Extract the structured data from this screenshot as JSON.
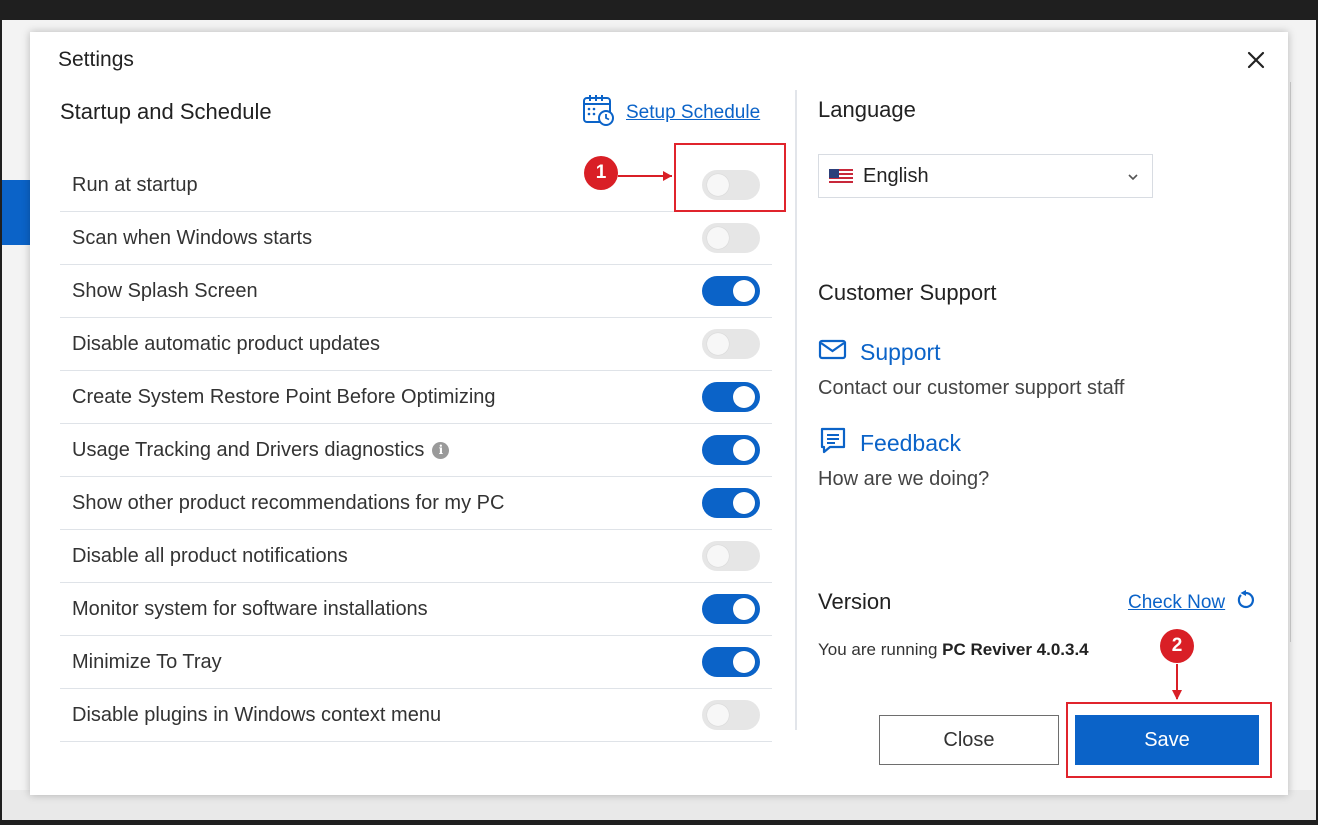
{
  "dialog": {
    "title": "Settings"
  },
  "startup": {
    "heading": "Startup and Schedule",
    "schedule_link": "Setup Schedule",
    "items": [
      {
        "label": "Run at startup",
        "on": false
      },
      {
        "label": "Scan when Windows starts",
        "on": false
      },
      {
        "label": "Show Splash Screen",
        "on": true
      },
      {
        "label": "Disable automatic product updates",
        "on": false
      },
      {
        "label": "Create System Restore Point Before Optimizing",
        "on": true
      },
      {
        "label": "Usage Tracking and Drivers diagnostics",
        "on": true,
        "info": true
      },
      {
        "label": "Show other product recommendations for my PC",
        "on": true
      },
      {
        "label": "Disable all product notifications",
        "on": false
      },
      {
        "label": "Monitor system for software installations",
        "on": true
      },
      {
        "label": "Minimize To Tray",
        "on": true
      },
      {
        "label": "Disable plugins in Windows context menu",
        "on": false
      }
    ]
  },
  "language": {
    "heading": "Language",
    "selected": "English",
    "flag_icon": "us-flag-icon"
  },
  "support": {
    "heading": "Customer Support",
    "support_label": "Support",
    "support_desc": "Contact our customer support staff",
    "feedback_label": "Feedback",
    "feedback_desc": "How are we doing?"
  },
  "version": {
    "heading": "Version",
    "check_now": "Check Now",
    "prefix": "You are running",
    "product": "PC Reviver 4.0.3.4"
  },
  "buttons": {
    "close": "Close",
    "save": "Save"
  },
  "annotations": {
    "badge1": "1",
    "badge2": "2"
  },
  "colors": {
    "accent": "#0b63c8",
    "annotation": "#d91f26"
  }
}
